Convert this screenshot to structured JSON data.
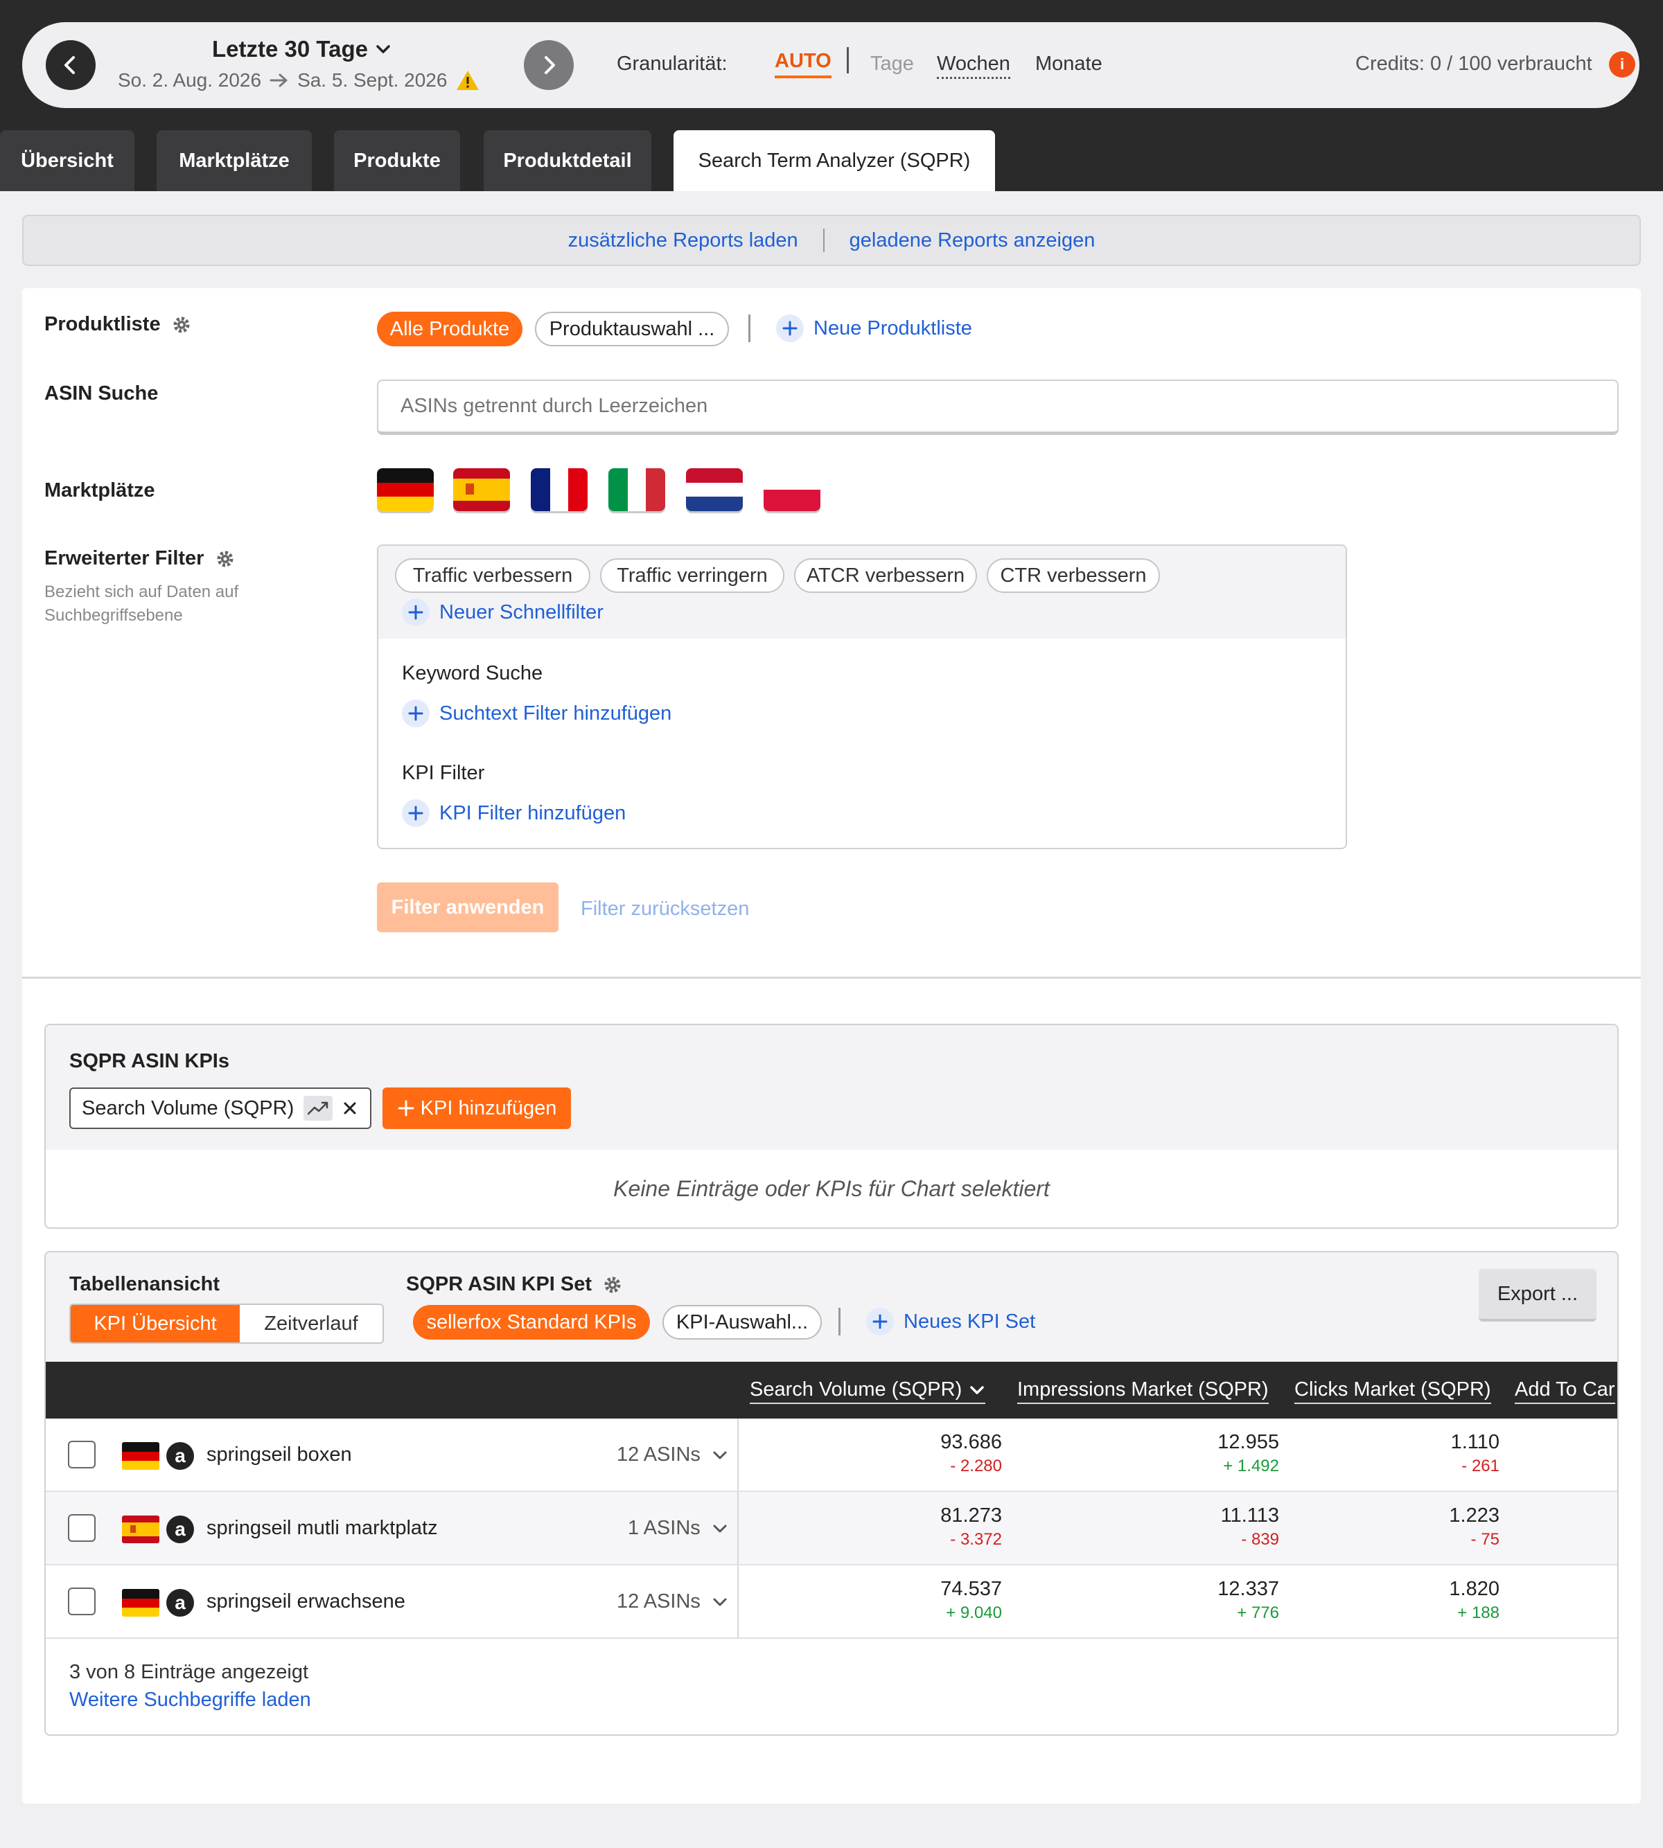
{
  "daterange": {
    "title": "Letzte 30 Tage",
    "start": "So. 2. Aug. 2026",
    "end": "Sa. 5. Sept. 2026"
  },
  "granularity": {
    "label": "Granularität:",
    "auto": "AUTO",
    "tage": "Tage",
    "wochen": "Wochen",
    "monate": "Monate"
  },
  "credits": {
    "text": "Credits: 0 / 100 verbraucht",
    "info": "i"
  },
  "tabs": [
    {
      "label": "Übersicht"
    },
    {
      "label": "Marktplätze"
    },
    {
      "label": "Produkte"
    },
    {
      "label": "Produktdetail"
    },
    {
      "label": "Search Term Analyzer (SQPR)"
    }
  ],
  "reports": {
    "load": "zusätzliche Reports laden",
    "show": "geladene Reports anzeigen"
  },
  "filters": {
    "productlist_label": "Produktliste",
    "all_products": "Alle Produkte",
    "product_select": "Produktauswahl ...",
    "new_list": "Neue Produktliste",
    "asin_label": "ASIN Suche",
    "asin_placeholder": "ASINs getrennt durch Leerzeichen",
    "marketplaces_label": "Marktplätze",
    "advanced_label": "Erweiterter Filter",
    "advanced_sub": "Bezieht sich auf Daten auf Suchbegriffsebene",
    "quick_filters": [
      "Traffic verbessern",
      "Traffic verringern",
      "ATCR verbessern",
      "CTR verbessern"
    ],
    "new_quickfilter": "Neuer Schnellfilter",
    "keyword_label": "Keyword Suche",
    "add_text_filter": "Suchtext Filter hinzufügen",
    "kpi_label": "KPI Filter",
    "add_kpi_filter": "KPI Filter hinzufügen",
    "apply": "Filter anwenden",
    "reset": "Filter zurücksetzen"
  },
  "kpi_chart": {
    "title": "SQPR ASIN KPIs",
    "chip": "Search Volume (SQPR)",
    "add": "KPI hinzufügen",
    "empty": "Keine Einträge oder KPIs für Chart selektiert"
  },
  "table": {
    "view_label": "Tabellenansicht",
    "view_on": "KPI Übersicht",
    "view_off": "Zeitverlauf",
    "kpiset_label": "SQPR ASIN KPI Set",
    "kpiset_active": "sellerfox Standard KPIs",
    "kpiset_select": "KPI-Auswahl...",
    "new_kpiset": "Neues KPI Set",
    "export": "Export ...",
    "columns": [
      "Search Volume (SQPR)",
      "Impressions Market (SQPR)",
      "Clicks Market (SQPR)",
      "Add To Car"
    ],
    "rows": [
      {
        "term": "springseil boxen",
        "asins": "12 ASINs",
        "flag": "de",
        "sv": "93.686",
        "sv_d": "- 2.280",
        "im": "12.955",
        "im_d": "+ 1.492",
        "cl": "1.110",
        "cl_d": "- 261"
      },
      {
        "term": "springseil mutli marktplatz",
        "asins": "1 ASINs",
        "flag": "es",
        "sv": "81.273",
        "sv_d": "- 3.372",
        "im": "11.113",
        "im_d": "- 839",
        "cl": "1.223",
        "cl_d": "- 75"
      },
      {
        "term": "springseil erwachsene",
        "asins": "12 ASINs",
        "flag": "de",
        "sv": "74.537",
        "sv_d": "+ 9.040",
        "im": "12.337",
        "im_d": "+ 776",
        "cl": "1.820",
        "cl_d": "+ 188"
      }
    ],
    "shown": "3 von 8 Einträge angezeigt",
    "load_more": "Weitere Suchbegriffe laden"
  },
  "colors": {
    "accent": "#ff6a13",
    "dark": "#2a2a2b",
    "link": "#1f5fd6",
    "negative": "#d12020",
    "positive": "#1a9a3a"
  }
}
